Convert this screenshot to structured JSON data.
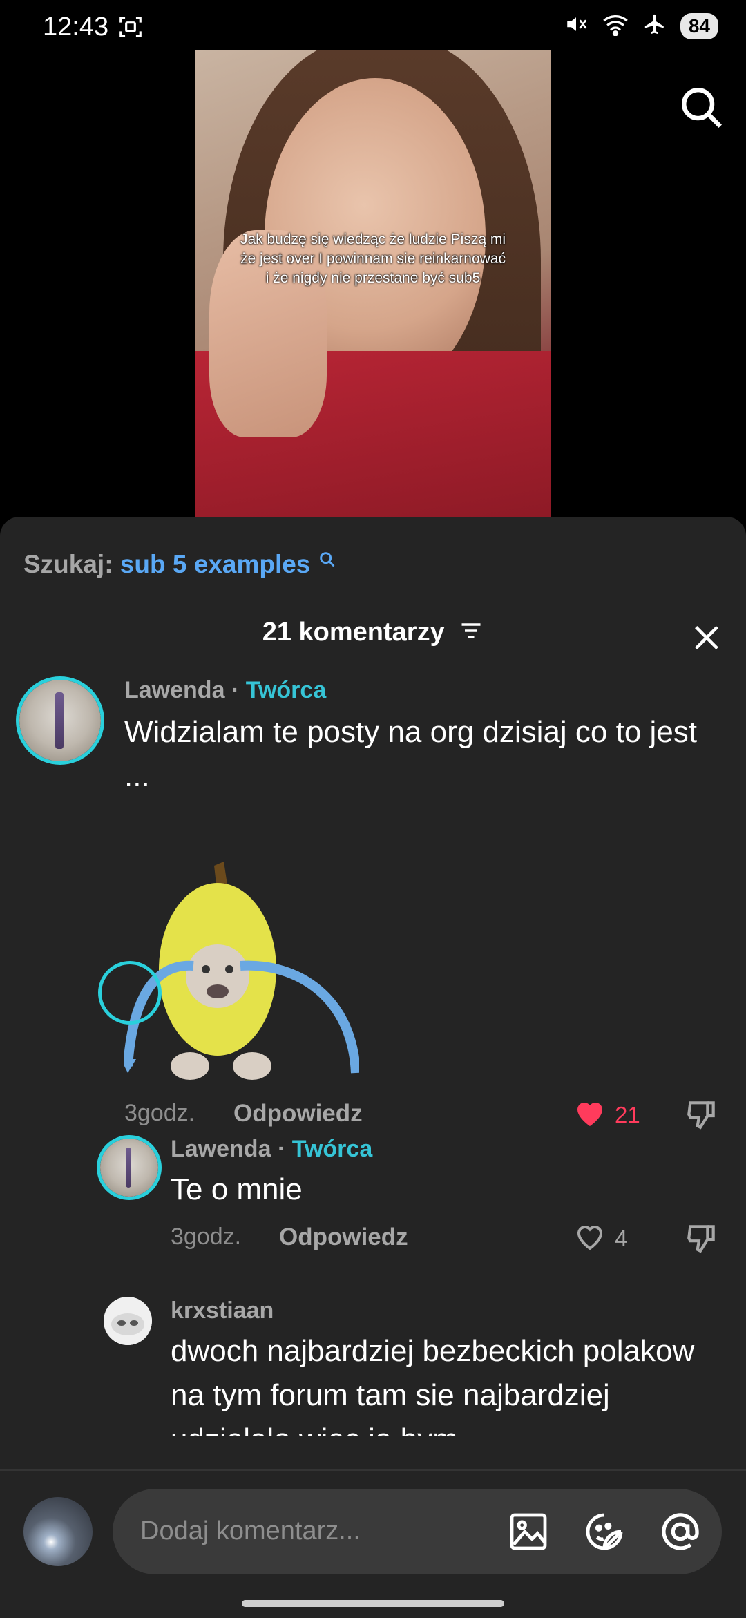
{
  "status_bar": {
    "time": "12:43",
    "battery": "84"
  },
  "video": {
    "caption": "Jak budzę się wiedząc że ludzie Piszą mi że jest over I powinnam sie reinkarnować i że nigdy nie przestane być sub5"
  },
  "search_suggestion": {
    "label": "Szukaj:",
    "query": "sub 5 examples"
  },
  "comments_panel": {
    "title": "21 komentarzy"
  },
  "comments": [
    {
      "author": "Lawenda",
      "separator": "·",
      "badge": "Twórca",
      "text": "Widzialam te posty na org dzisiaj co to jest ...",
      "time": "3godz.",
      "reply_label": "Odpowiedz",
      "likes": "21"
    },
    {
      "author": "Lawenda",
      "separator": "·",
      "badge": "Twórca",
      "text": "Te o mnie",
      "time": "3godz.",
      "reply_label": "Odpowiedz",
      "likes": "4"
    },
    {
      "author": "krxstiaan",
      "text": "dwoch najbardziej bezbeckich polakow na tym forum tam sie najbardziej udzielalo wiec ja bym"
    }
  ],
  "composer": {
    "placeholder": "Dodaj komentarz..."
  },
  "colors": {
    "accent_blue": "#5aa8f5",
    "creator_teal": "#36c4d6",
    "like_red": "#ff3b5c",
    "sheet_bg": "#242424"
  }
}
